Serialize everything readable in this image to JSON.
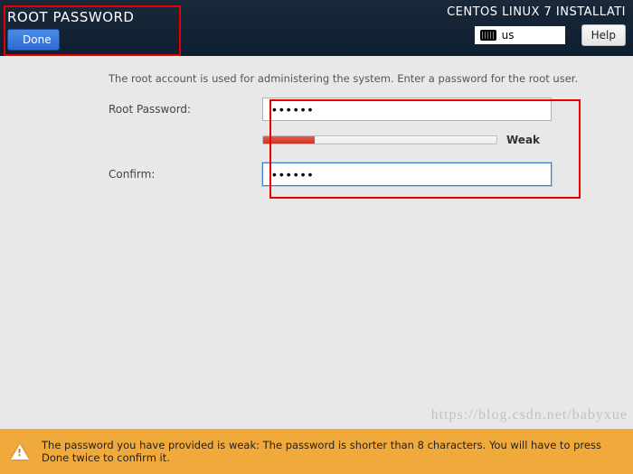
{
  "header": {
    "title": "ROOT PASSWORD",
    "done_label": "Done",
    "install_title": "CENTOS LINUX 7 INSTALLATI",
    "keyboard_layout": "us",
    "help_label": "Help"
  },
  "form": {
    "instruction": "The root account is used for administering the system.  Enter a password for the root user.",
    "password_label": "Root Password:",
    "confirm_label": "Confirm:",
    "password_value": "••••••",
    "confirm_value": "••••••",
    "strength_text": "Weak"
  },
  "warning": {
    "message": "The password you have provided is weak: The password is shorter than 8 characters. You will have to press Done twice to confirm it."
  },
  "watermark": "https://blog.csdn.net/babyxue"
}
